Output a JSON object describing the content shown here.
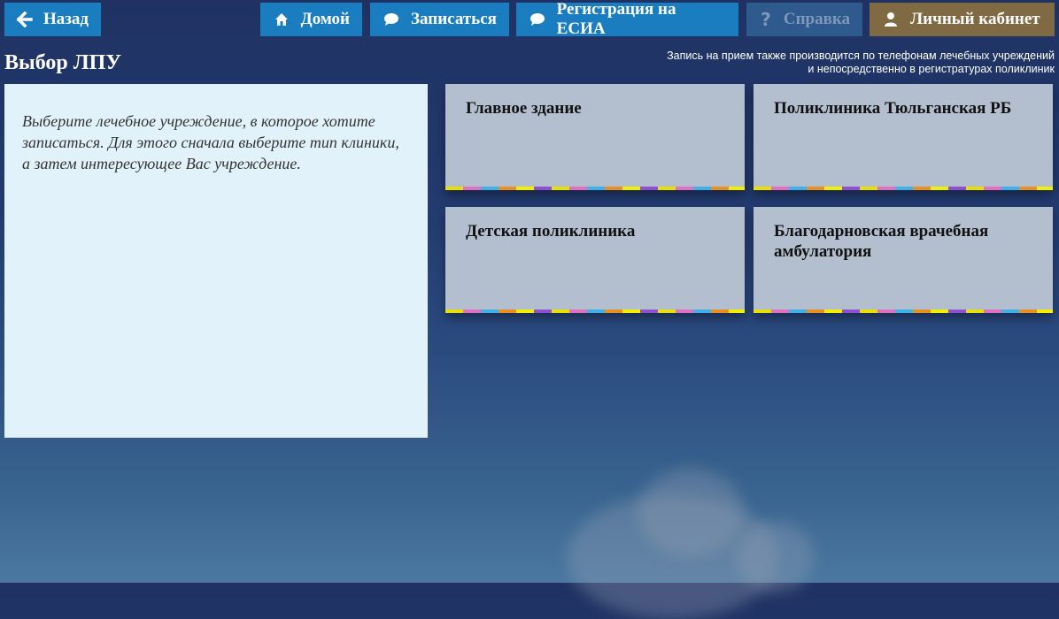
{
  "nav": {
    "back_label": "Назад",
    "home_label": "Домой",
    "signup_label": "Записаться",
    "esia_label": "Регистрация на ЕСИА",
    "help_label": "Справка",
    "cabinet_label": "Личный кабинет"
  },
  "page": {
    "title": "Выбор ЛПУ",
    "notice_line1": "Запись на прием также производится по телефонам лечебных учреждений",
    "notice_line2": "и непосредственно в регистратурах поликлиник",
    "info_text": "Выберите лечебное учреждение, в которое хотите записаться. Для этого сначала выберите тип клиники, а затем интересующее Вас учреждение."
  },
  "clinics": [
    {
      "name": "Главное здание"
    },
    {
      "name": "Поликлиника Тюльганская РБ"
    },
    {
      "name": "Детская поликлиника"
    },
    {
      "name": "Благодарновская врачебная амбулатория"
    }
  ],
  "colors": {
    "nav_blue": "#1a7dc0",
    "nav_disabled": "#2e5a8e",
    "nav_brown": "#806a44",
    "card_bg": "#b3bfcf",
    "info_bg": "#e1f2fa"
  }
}
